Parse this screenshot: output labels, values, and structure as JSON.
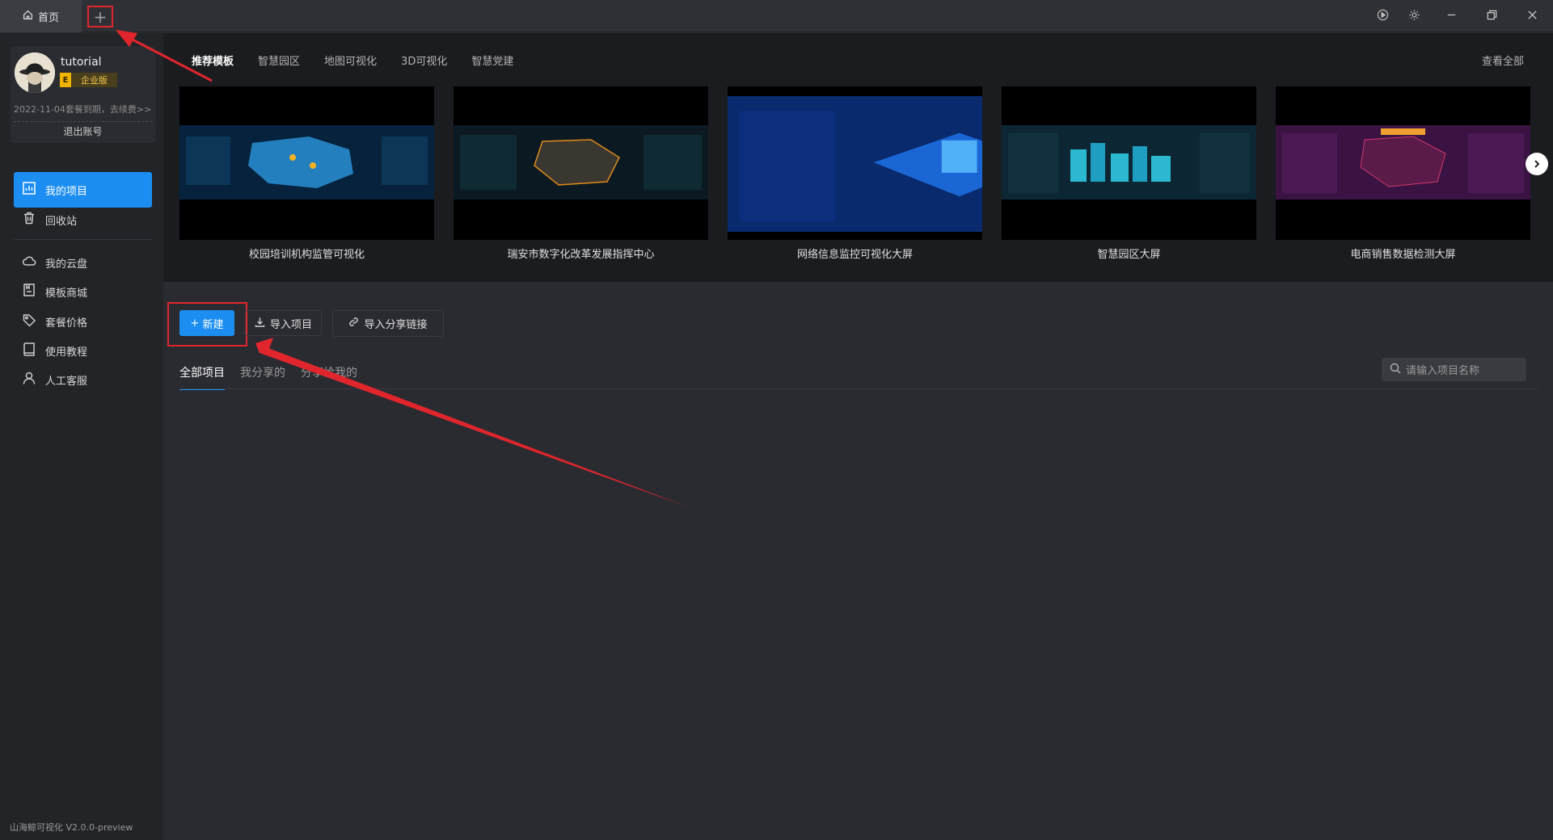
{
  "titlebar": {
    "home_tab": "首页",
    "add_tab": "+",
    "controls": [
      "play-icon",
      "settings-icon",
      "minimize-icon",
      "restore-icon",
      "close-icon"
    ]
  },
  "user": {
    "name": "tutorial",
    "edition_badge": "E",
    "edition": "企业版",
    "expire_note": "2022-11-04套餐到期，去续费>>",
    "logout": "退出账号"
  },
  "sidebar": {
    "items": [
      {
        "label": "我的项目",
        "icon": "chart-icon"
      },
      {
        "label": "回收站",
        "icon": "trash-icon"
      },
      {
        "label": "我的云盘",
        "icon": "cloud-icon"
      },
      {
        "label": "模板商城",
        "icon": "template-icon"
      },
      {
        "label": "套餐价格",
        "icon": "tag-icon"
      },
      {
        "label": "使用教程",
        "icon": "book-icon"
      },
      {
        "label": "人工客服",
        "icon": "user-icon"
      }
    ],
    "version": "山海鲸可视化 V2.0.0-preview"
  },
  "templates": {
    "tabs": [
      "推荐模板",
      "智慧园区",
      "地图可视化",
      "3D可视化",
      "智慧党建"
    ],
    "view_all": "查看全部",
    "cards": [
      {
        "title": "校园培训机构监管可视化",
        "color": "#1f6fb0"
      },
      {
        "title": "瑞安市数字化改革发展指挥中心",
        "color": "#1f3b47"
      },
      {
        "title": "网络信息监控可视化大屏",
        "color": "#0d3fa0"
      },
      {
        "title": "智慧园区大屏",
        "color": "#123c52"
      },
      {
        "title": "电商销售数据检测大屏",
        "color": "#4a1a52"
      }
    ]
  },
  "toolbar": {
    "new": "新建",
    "import": "导入项目",
    "import_share": "导入分享链接"
  },
  "projects": {
    "tabs": [
      "全部项目",
      "我分享的",
      "分享给我的"
    ],
    "search_placeholder": "请输入项目名称"
  },
  "colors": {
    "accent": "#1c8ef2",
    "highlight": "#e0262c",
    "edition": "#f0b400"
  }
}
